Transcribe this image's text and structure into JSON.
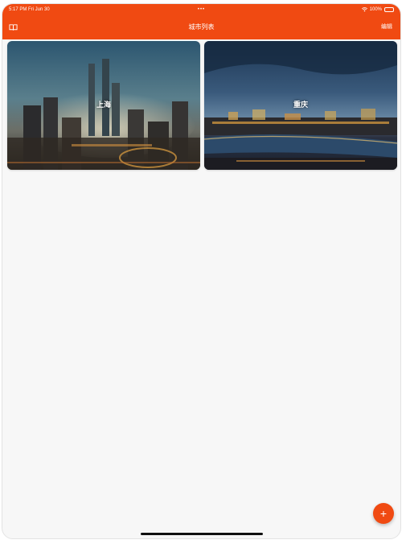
{
  "status_bar": {
    "time_date": "5:17 PM  Fri Jun 30",
    "dots": "•••",
    "battery_text": "100%"
  },
  "nav_bar": {
    "title": "城市列表",
    "edit_label": "编辑",
    "left_icon": "book-icon"
  },
  "cities": [
    {
      "name": "上海"
    },
    {
      "name": "重庆"
    }
  ],
  "fab": {
    "label": "+"
  },
  "colors": {
    "accent": "#f04a12",
    "background": "#f7f7f7"
  }
}
